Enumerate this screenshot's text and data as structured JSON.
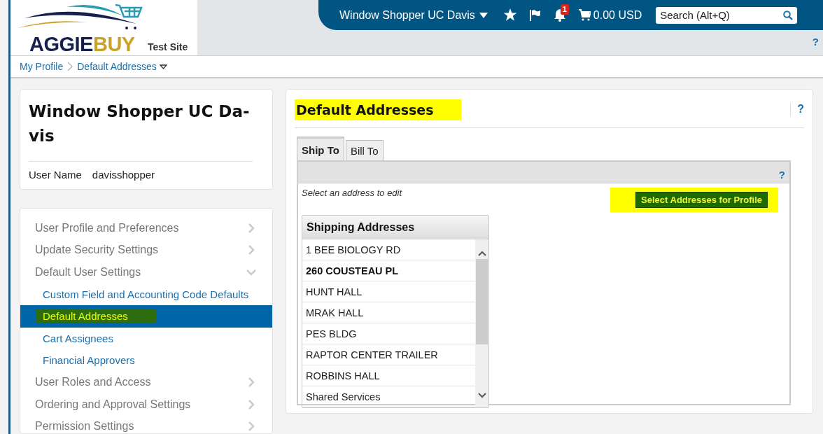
{
  "logo": {
    "name_1": "AGGIE",
    "name_2": "BUY",
    "tagline": "Test Site"
  },
  "top_bar": {
    "user_menu": "Window Shopper UC Davis",
    "notification_count": "1",
    "cart_total": "0.00 USD",
    "search": {
      "placeholder": "Search (Alt+Q)"
    },
    "help": "?"
  },
  "breadcrumb": [
    {
      "label": "My Profile",
      "dropdown": false
    },
    {
      "label": "Default Addresses",
      "dropdown": true
    }
  ],
  "profile": {
    "name": "Window Shopper UC Da-vis",
    "user_name_label": "User Name",
    "user_name": "davisshopper"
  },
  "sidebar": {
    "items": [
      {
        "label": "User Profile and Preferences",
        "expanded": false
      },
      {
        "label": "Update Security Settings",
        "expanded": false
      },
      {
        "label": "Default User Settings",
        "expanded": true,
        "children": [
          {
            "label": "Custom Field and Accounting Code Defaults",
            "selected": false,
            "highlighted": false
          },
          {
            "label": "Default Addresses",
            "selected": true,
            "highlighted": true
          },
          {
            "label": "Cart Assignees",
            "selected": false,
            "highlighted": false
          },
          {
            "label": "Financial Approvers",
            "selected": false,
            "highlighted": false
          }
        ]
      },
      {
        "label": "User Roles and Access",
        "expanded": false
      },
      {
        "label": "Ordering and Approval Settings",
        "expanded": false
      },
      {
        "label": "Permission Settings",
        "expanded": false
      }
    ]
  },
  "main": {
    "title": "Default Addresses",
    "title_highlighted": true,
    "help": "?",
    "tabs": [
      {
        "label": "Ship To",
        "selected": true
      },
      {
        "label": "Bill To",
        "selected": false
      }
    ],
    "panel_help": "?",
    "hint": "Select an address to edit",
    "action_button": {
      "label": "Select Addresses for Profile",
      "highlighted": true
    },
    "address_list": {
      "heading": "Shipping Addresses",
      "rows": [
        {
          "label": "1 BEE BIOLOGY RD",
          "selected": false
        },
        {
          "label": "260 COUSTEAU PL",
          "selected": true
        },
        {
          "label": "HUNT HALL",
          "selected": false
        },
        {
          "label": "MRAK HALL",
          "selected": false
        },
        {
          "label": "PES BLDG",
          "selected": false
        },
        {
          "label": "RAPTOR CENTER TRAILER",
          "selected": false
        },
        {
          "label": "ROBBINS HALL",
          "selected": false
        },
        {
          "label": "Shared Services",
          "selected": false
        }
      ]
    }
  }
}
